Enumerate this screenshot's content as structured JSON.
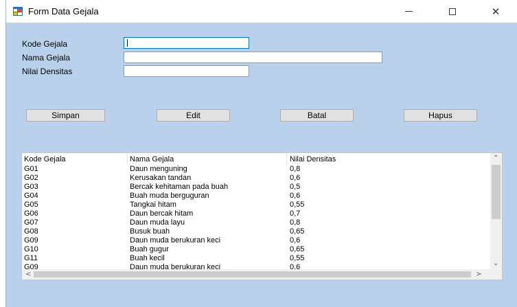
{
  "window": {
    "title": "Form Data Gejala",
    "controls": {
      "minimize": "minimize-icon",
      "maximize": "maximize-icon",
      "close": "✕"
    }
  },
  "form": {
    "kode_label": "Kode Gejala",
    "kode_value": "",
    "nama_label": "Nama Gejala",
    "nama_value": "",
    "nilai_label": "Nilai Densitas",
    "nilai_value": ""
  },
  "buttons": {
    "simpan": "Simpan",
    "edit": "Edit",
    "batal": "Batal",
    "hapus": "Hapus"
  },
  "table": {
    "columns": [
      "Kode Gejala",
      "Nama Gejala",
      "Nilai Densitas"
    ],
    "rows": [
      [
        "G01",
        "Daun menguning",
        "0,8"
      ],
      [
        "G02",
        "Kerusakan tandan",
        "0,6"
      ],
      [
        "G03",
        "Bercak kehitaman pada buah",
        "0,5"
      ],
      [
        "G04",
        "Buah muda berguguran",
        "0,6"
      ],
      [
        "G05",
        "Tangkai hitam",
        "0,55"
      ],
      [
        "G06",
        "Daun bercak hitam",
        "0,7"
      ],
      [
        "G07",
        "Daun muda layu",
        "0,8"
      ],
      [
        "G08",
        "Busuk buah",
        "0,65"
      ],
      [
        "G09",
        "Daun muda berukuran keci",
        "0,6"
      ],
      [
        "G10",
        "Buah gugur",
        "0,65"
      ],
      [
        "G11",
        "Buah kecil",
        "0,55"
      ],
      [
        "G09",
        "Daun muda berukuran keci",
        "0,6"
      ]
    ]
  },
  "colors": {
    "form_bg": "#b9d1ea",
    "button_bg": "#e1e1e1",
    "focus_border": "#0078d7"
  }
}
